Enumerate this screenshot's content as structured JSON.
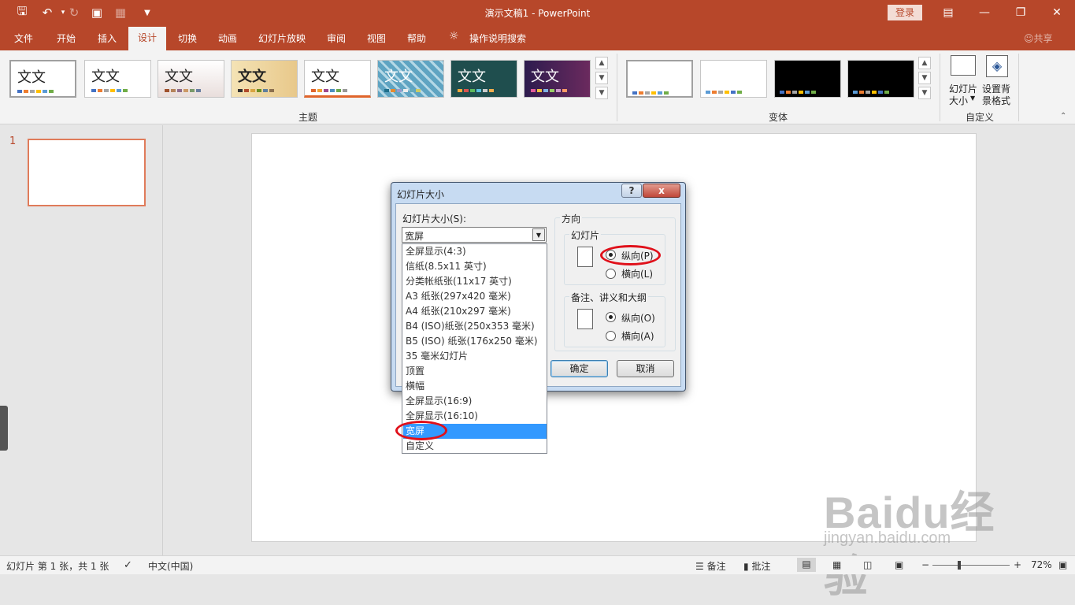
{
  "window": {
    "title": "演示文稿1  -  PowerPoint",
    "login": "登录",
    "share": "共享"
  },
  "tabs": [
    "文件",
    "开始",
    "插入",
    "设计",
    "切换",
    "动画",
    "幻灯片放映",
    "审阅",
    "视图",
    "帮助"
  ],
  "tell_me": "操作说明搜索",
  "ribbon": {
    "theme_sample": "文文",
    "groups": {
      "themes": "主题",
      "variants": "变体",
      "customize": "自定义"
    },
    "slide_size": "幻灯片\n大小",
    "slide_size_label1": "幻灯片",
    "slide_size_label2": "大小",
    "format_bg_label1": "设置背",
    "format_bg_label2": "景格式"
  },
  "slides_panel": {
    "number": "1"
  },
  "dialog": {
    "title": "幻灯片大小",
    "help": "?",
    "close": "x",
    "size_label": "幻灯片大小(S):",
    "size_value": "宽屏",
    "options": [
      "全屏显示(4:3)",
      "信纸(8.5x11 英寸)",
      "分类帐纸张(11x17 英寸)",
      "A3 纸张(297x420 毫米)",
      "A4 纸张(210x297 毫米)",
      "B4 (ISO)纸张(250x353 毫米)",
      "B5 (ISO) 纸张(176x250 毫米)",
      "35 毫米幻灯片",
      "顶置",
      "横幅",
      "全屏显示(16:9)",
      "全屏显示(16:10)",
      "宽屏",
      "自定义"
    ],
    "selected_option": "宽屏",
    "orientation_title": "方向",
    "slides_group": "幻灯片",
    "slides_portrait": "纵向(P)",
    "slides_landscape": "横向(L)",
    "notes_group": "备注、讲义和大纲",
    "notes_portrait": "纵向(O)",
    "notes_landscape": "横向(A)",
    "ok": "确定",
    "cancel": "取消"
  },
  "status": {
    "slide_info": "幻灯片 第 1 张，共 1 张",
    "language": "中文(中国)",
    "notes": "备注",
    "comments": "批注",
    "zoom": "72%",
    "minus": "−",
    "plus": "+"
  },
  "watermark": {
    "main": "Baidu经验",
    "sub": "jingyan.baidu.com"
  },
  "colors": {
    "accent": "#b7472a",
    "highlight": "#e0101a",
    "selected": "#3399ff"
  }
}
